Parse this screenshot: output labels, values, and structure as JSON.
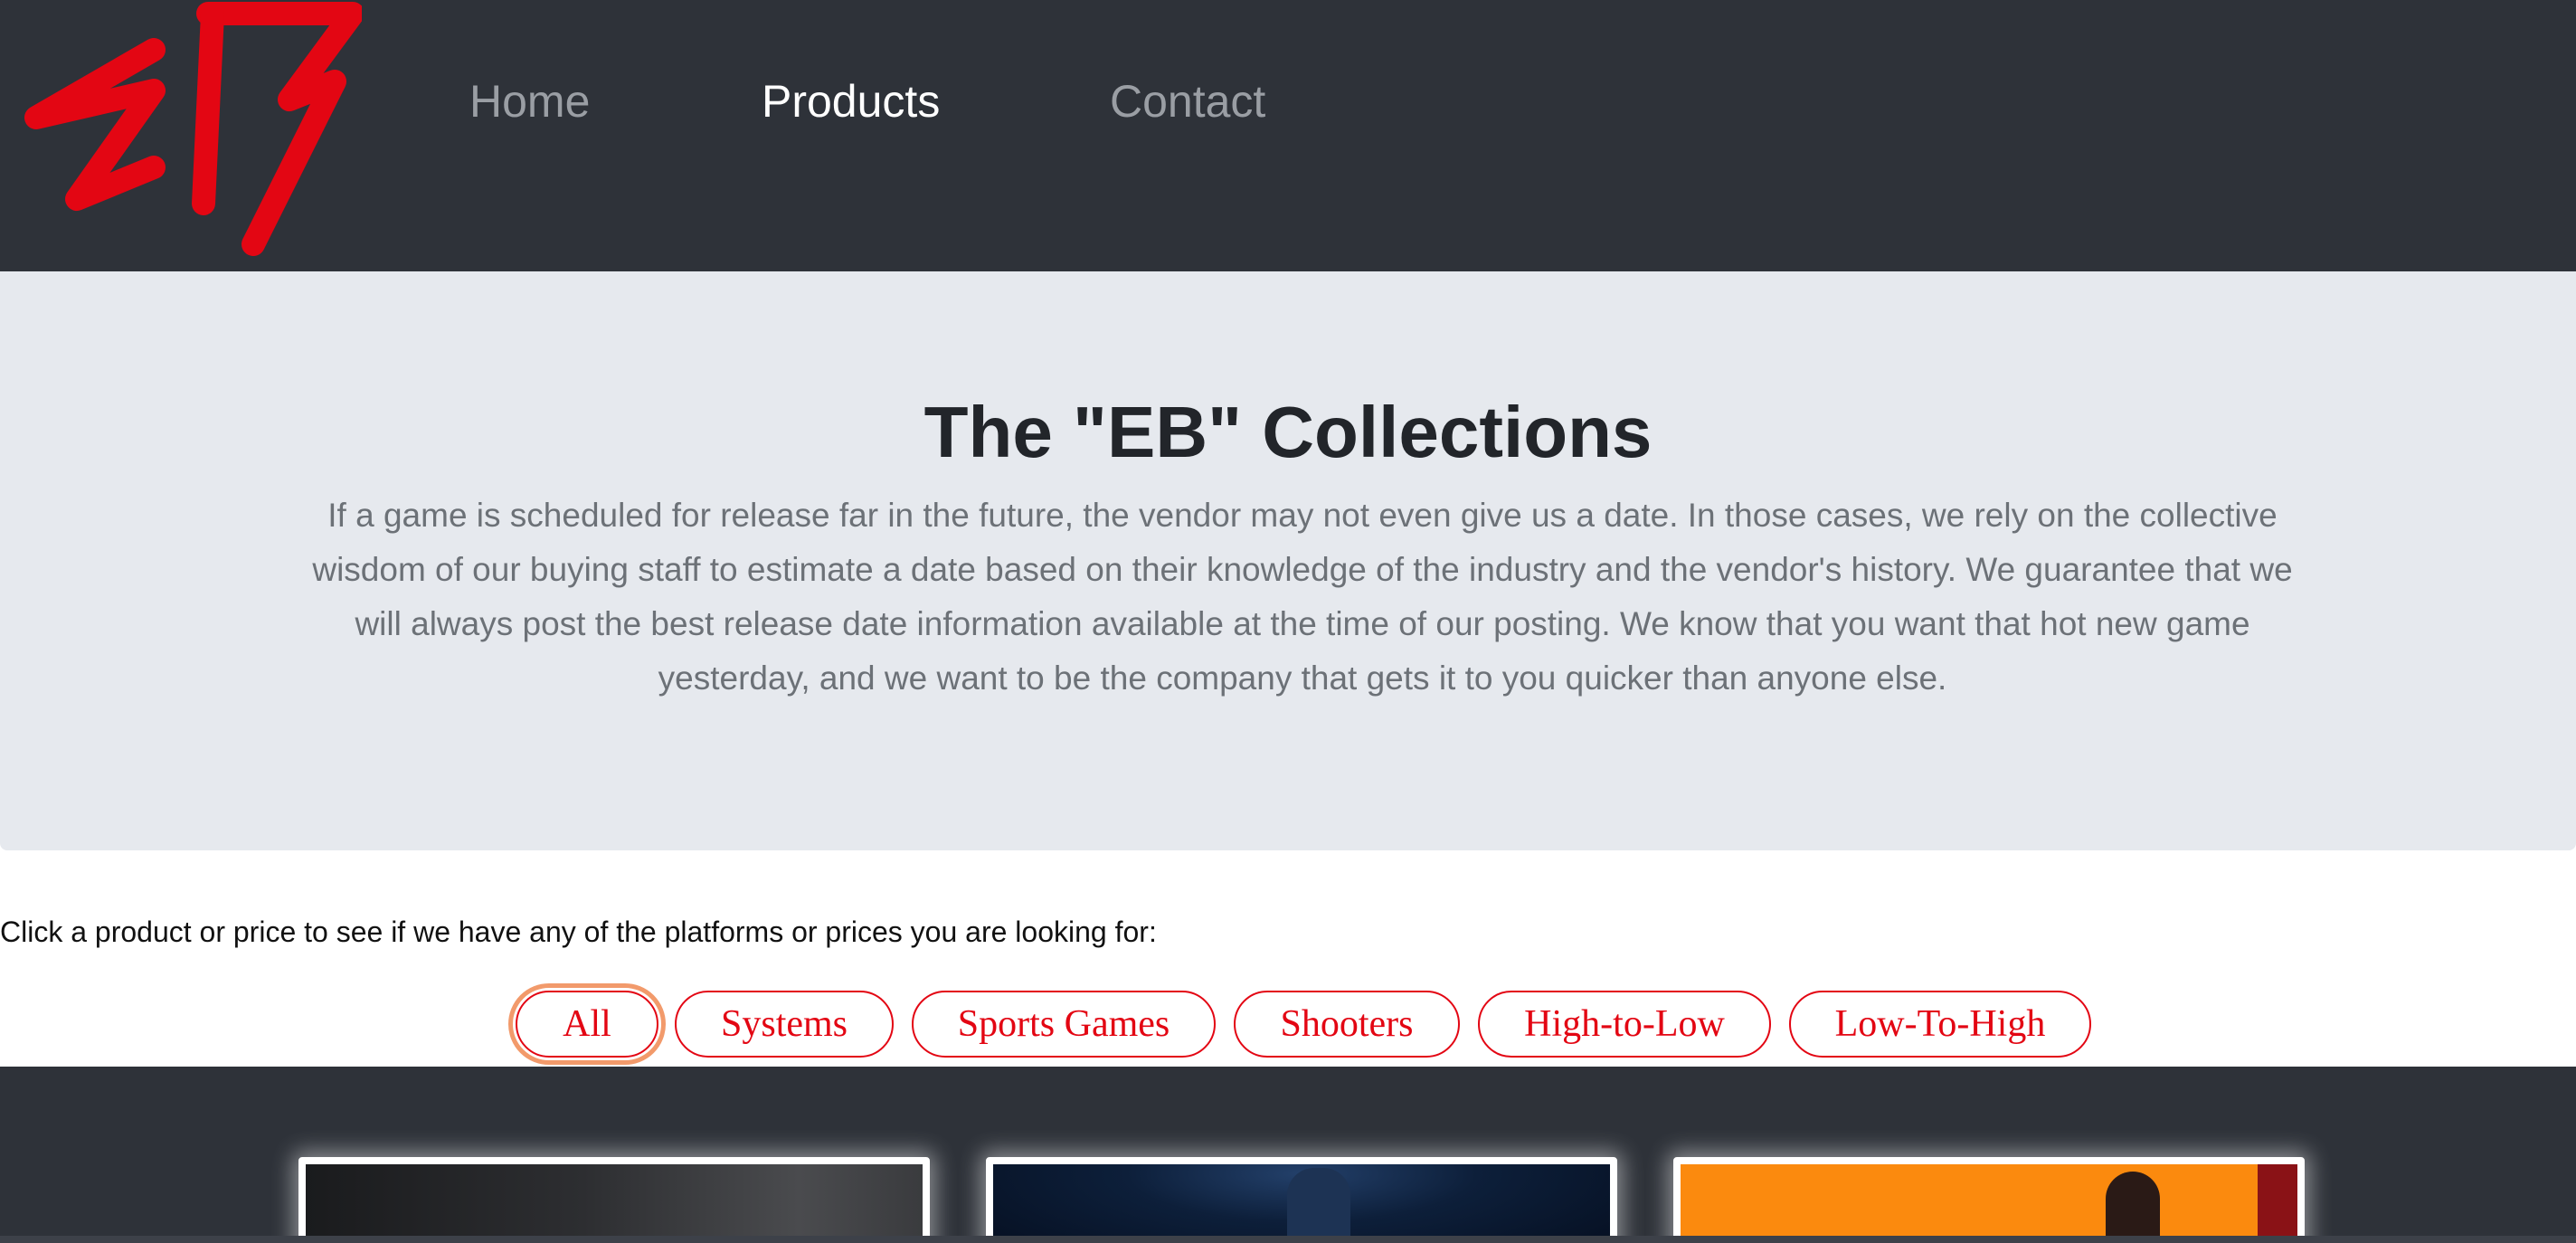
{
  "nav": {
    "logo_alt": "EB",
    "links": [
      {
        "label": "Home"
      },
      {
        "label": "Products"
      },
      {
        "label": "Contact"
      }
    ]
  },
  "jumbotron": {
    "title": "The \"EB\" Collections",
    "text": "If a game is scheduled for release far in the future, the vendor may not even give us a date. In those cases, we rely on the collective wisdom of our buying staff to estimate a date based on their knowledge of the industry and the vendor's history. We guarantee that we will always post the best release date information available at the time of our posting. We know that you want that hot new game yesterday, and we want to be the company that gets it to you quicker than anyone else."
  },
  "instruction": "Click a product or price to see if we have any of the platforms or prices you are looking for:",
  "filters": [
    {
      "label": "All",
      "active": true
    },
    {
      "label": "Systems"
    },
    {
      "label": "Sports Games"
    },
    {
      "label": "Shooters"
    },
    {
      "label": "High-to-Low"
    },
    {
      "label": "Low-To-High"
    }
  ],
  "colors": {
    "brand_red": "#e30613",
    "nav_bg": "#2e3239",
    "jumbotron_bg": "#e6e9ee"
  }
}
